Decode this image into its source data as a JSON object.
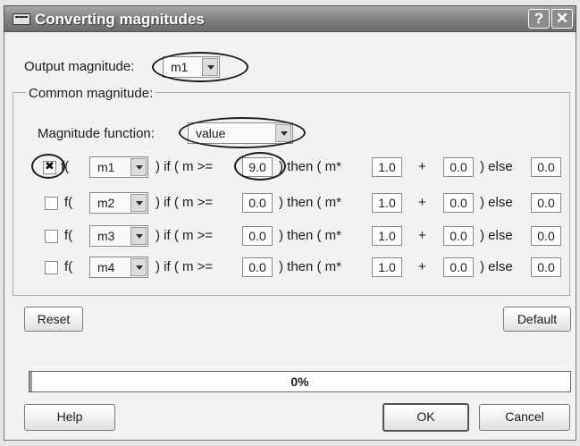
{
  "window": {
    "title": "Converting magnitudes",
    "help_glyph": "?",
    "close_glyph": "✕"
  },
  "output_magnitude": {
    "label": "Output magnitude:",
    "value": "m1"
  },
  "common": {
    "legend": "Common magnitude:",
    "function_label": "Magnitude function:",
    "function_value": "value"
  },
  "formula": {
    "f_open": "f(",
    "if_text": ") if ( m >=",
    "then_text": ") then ( m*",
    "plus": "+",
    "else_text": ") else"
  },
  "rows": [
    {
      "checked": true,
      "magnitude": "m1",
      "threshold": "9.0",
      "multiplier": "1.0",
      "offset": "0.0",
      "else": "0.0"
    },
    {
      "checked": false,
      "magnitude": "m2",
      "threshold": "0.0",
      "multiplier": "1.0",
      "offset": "0.0",
      "else": "0.0"
    },
    {
      "checked": false,
      "magnitude": "m3",
      "threshold": "0.0",
      "multiplier": "1.0",
      "offset": "0.0",
      "else": "0.0"
    },
    {
      "checked": false,
      "magnitude": "m4",
      "threshold": "0.0",
      "multiplier": "1.0",
      "offset": "0.0",
      "else": "0.0"
    }
  ],
  "buttons": {
    "reset": "Reset",
    "default": "Default",
    "help": "Help",
    "ok": "OK",
    "cancel": "Cancel"
  },
  "progress": {
    "label": "0%",
    "value": 0.0
  }
}
